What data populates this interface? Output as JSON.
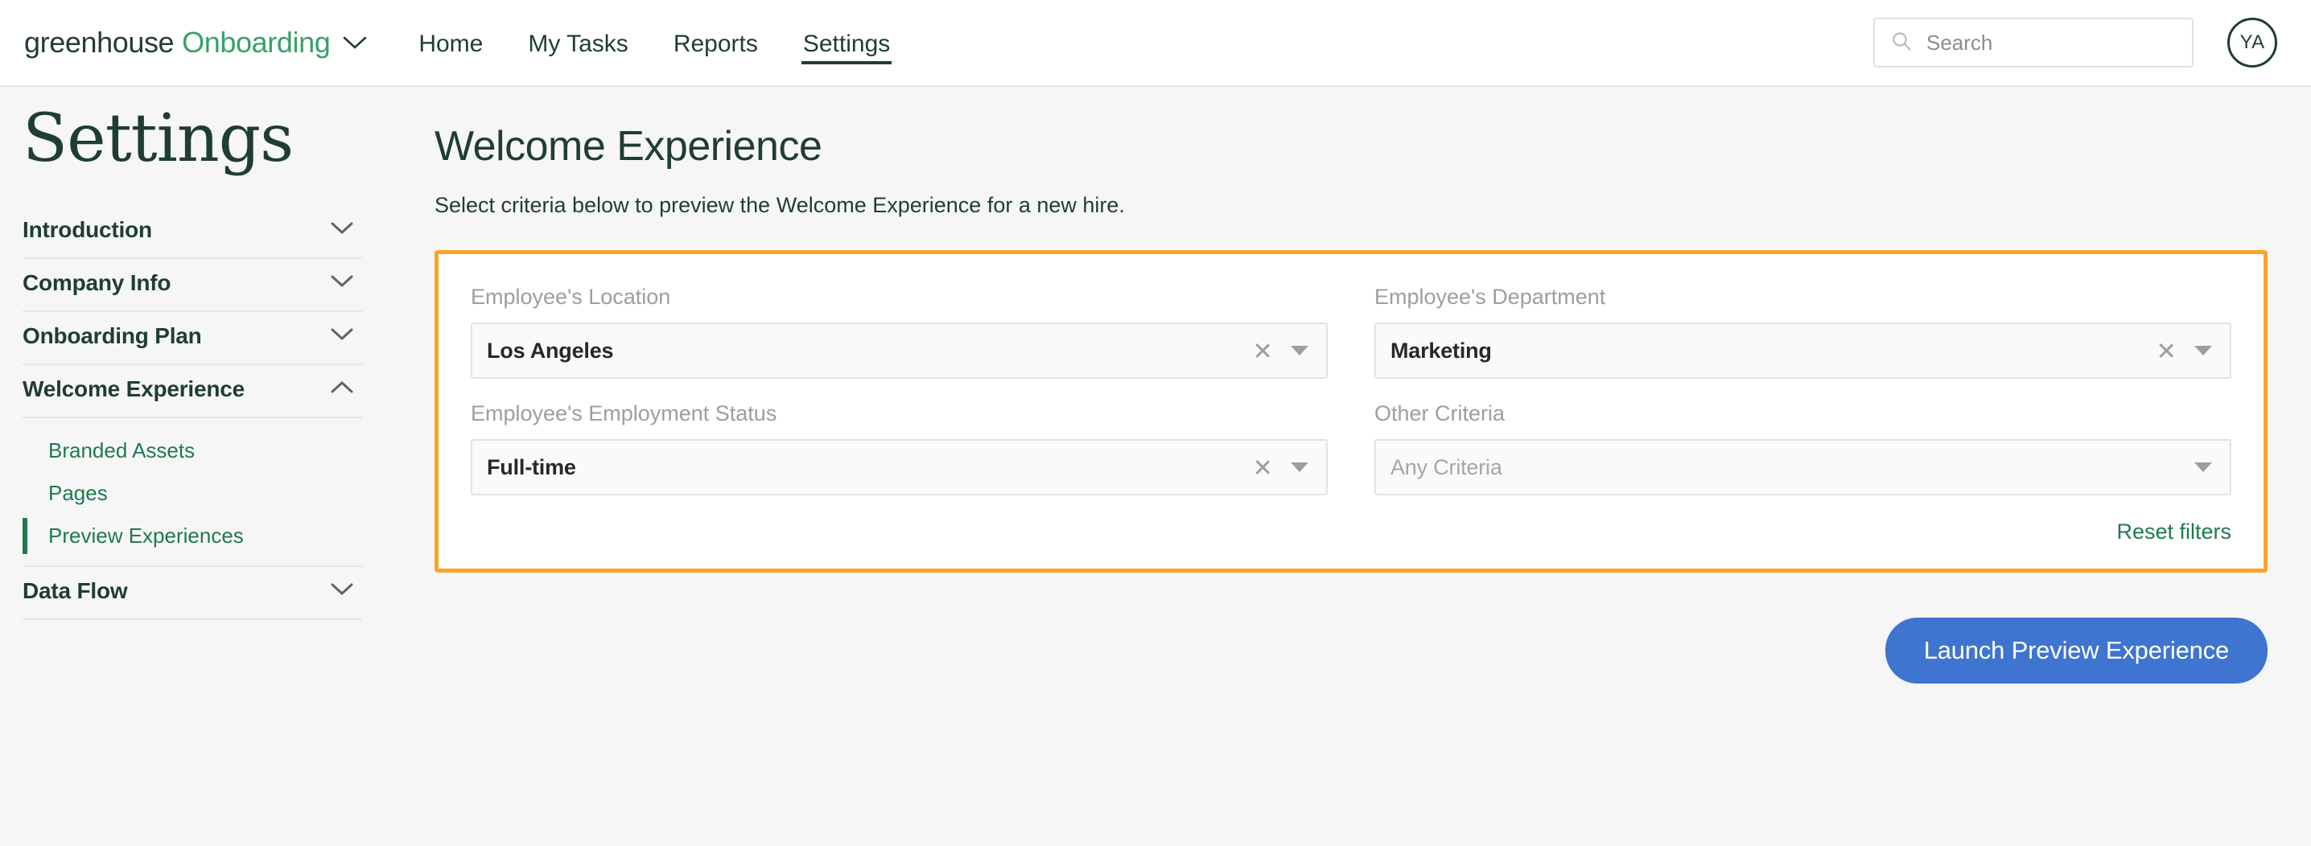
{
  "header": {
    "brand": {
      "name": "greenhouse",
      "product": "Onboarding",
      "caret_icon": "chevron-down-icon"
    },
    "nav": [
      {
        "label": "Home",
        "active": false
      },
      {
        "label": "My Tasks",
        "active": false
      },
      {
        "label": "Reports",
        "active": false
      },
      {
        "label": "Settings",
        "active": true
      }
    ],
    "search": {
      "placeholder": "Search",
      "value": "",
      "icon": "search-icon"
    },
    "avatar": {
      "initials": "YA"
    }
  },
  "sidebar": {
    "title": "Settings",
    "sections": [
      {
        "label": "Introduction",
        "expanded": false,
        "chevron": "chevron-down-icon"
      },
      {
        "label": "Company Info",
        "expanded": false,
        "chevron": "chevron-down-icon"
      },
      {
        "label": "Onboarding Plan",
        "expanded": false,
        "chevron": "chevron-down-icon"
      },
      {
        "label": "Welcome Experience",
        "expanded": true,
        "chevron": "chevron-up-icon"
      },
      {
        "label": "Data Flow",
        "expanded": false,
        "chevron": "chevron-down-icon"
      }
    ],
    "welcome_sub_items": [
      {
        "label": "Branded Assets",
        "active": false
      },
      {
        "label": "Pages",
        "active": false
      },
      {
        "label": "Preview Experiences",
        "active": true
      }
    ]
  },
  "main": {
    "title": "Welcome Experience",
    "subtitle": "Select criteria below to preview the Welcome Experience for a new hire.",
    "filters": {
      "border_color": "#fca32c",
      "fields": [
        {
          "label": "Employee's Location",
          "value": "Los Angeles",
          "is_placeholder": false,
          "clearable": true
        },
        {
          "label": "Employee's Department",
          "value": "Marketing",
          "is_placeholder": false,
          "clearable": true
        },
        {
          "label": "Employee's Employment Status",
          "value": "Full-time",
          "is_placeholder": false,
          "clearable": true
        },
        {
          "label": "Other Criteria",
          "value": "Any Criteria",
          "is_placeholder": true,
          "clearable": false
        }
      ],
      "reset_label": "Reset filters"
    },
    "launch_button": {
      "label": "Launch Preview Experience",
      "color": "#3f75d0"
    }
  }
}
